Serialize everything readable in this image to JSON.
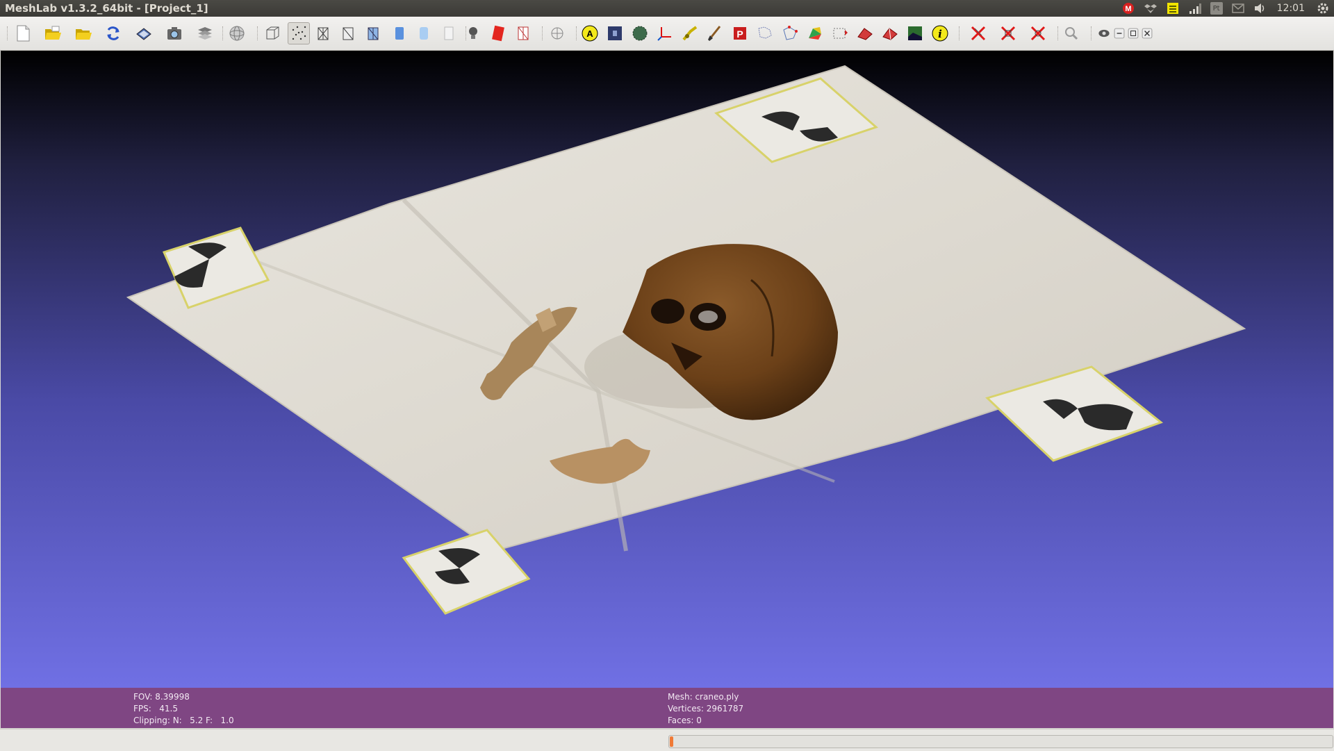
{
  "window": {
    "title": "MeshLab v1.3.2_64bit - [Project_1]"
  },
  "tray": {
    "icons": [
      "mail-icon",
      "dropbox-icon",
      "notes-icon",
      "signal-icon",
      "keyboard-icon",
      "envelope-icon",
      "volume-icon",
      "settings-icon"
    ],
    "keyboard_label": "Pt",
    "clock": "12:01"
  },
  "toolbar": {
    "icons": [
      "new-file-icon",
      "open-project-icon",
      "open-mesh-icon",
      "reload-icon",
      "save-icon",
      "snapshot-icon",
      "layers-icon",
      "trackball-icon",
      "bbox-icon",
      "points-icon",
      "wireframe-icon",
      "hidden-lines-icon",
      "flat-lines-icon",
      "flat-icon",
      "smooth-icon",
      "texture-icon",
      "light-icon",
      "double-light-icon",
      "bbox-grid-icon",
      "orbit-icon",
      "annotation-icon",
      "camera-info-icon",
      "sphere-texture-icon",
      "axis-icon",
      "measure-icon",
      "paint-icon",
      "pickpoints-icon",
      "align-icon",
      "select-vertices-icon",
      "select-faces-icon",
      "move-selection-icon",
      "delete-faces-icon",
      "delete-vertices-icon",
      "raster-icon",
      "info-icon",
      "close-x-icon",
      "close-x2-icon",
      "close-x3-icon",
      "zoom-icon",
      "eye-icon",
      "minimize-icon",
      "restore-icon",
      "close-icon"
    ]
  },
  "viewport": {
    "colors": {
      "top": "#000000",
      "bottom": "#7070e4"
    }
  },
  "info": {
    "fov_label": "FOV: 8.39998",
    "fps_label": "FPS:   41.5",
    "clipping_label": "Clipping: N:   5.2 F:   1.0",
    "mesh_label": "Mesh: craneo.ply",
    "vertices_label": "Vertices: 2961787",
    "faces_label": "Faces: 0"
  },
  "status": {
    "progress": 0.005
  }
}
